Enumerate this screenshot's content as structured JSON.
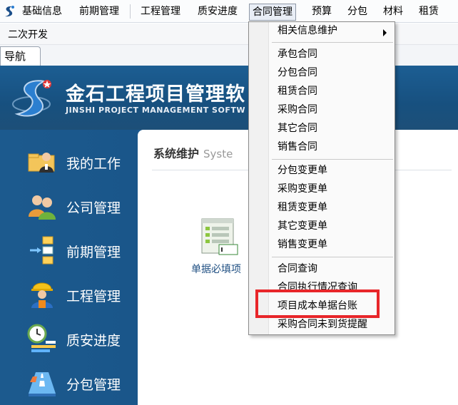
{
  "menubar": {
    "items": [
      "基础信息",
      "前期管理",
      "工程管理",
      "质安进度",
      "合同管理",
      "预算",
      "分包",
      "材料",
      "租赁"
    ],
    "active": "合同管理"
  },
  "toolbar": {
    "label": "二次开发"
  },
  "nav_tab": {
    "label": "导航"
  },
  "banner": {
    "title": "金石工程项目管理软",
    "subtitle": "JINSHI PROJECT MANAGEMENT SOFTW"
  },
  "sidebar": {
    "items": [
      {
        "label": "我的工作",
        "icon": "user-desk-icon"
      },
      {
        "label": "公司管理",
        "icon": "users-icon"
      },
      {
        "label": "前期管理",
        "icon": "flowchart-icon"
      },
      {
        "label": "工程管理",
        "icon": "worker-icon"
      },
      {
        "label": "质安进度",
        "icon": "clock-progress-icon"
      },
      {
        "label": "分包管理",
        "icon": "road-icon"
      }
    ]
  },
  "content": {
    "title": "系统维护",
    "subtitle": "Syste",
    "shortcut_label": "单据必填项"
  },
  "dropdown": {
    "items": [
      "相关信息维护",
      "承包合同",
      "分包合同",
      "租赁合同",
      "采购合同",
      "其它合同",
      "销售合同",
      "分包变更单",
      "采购变更单",
      "租赁变更单",
      "其它变更单",
      "销售变更单",
      "合同查询",
      "合同执行情况查询",
      "项目成本单据台账",
      "采购合同未到货提醒"
    ]
  },
  "colors": {
    "highlight": "#e8262a",
    "banner": "#1c5e93"
  }
}
